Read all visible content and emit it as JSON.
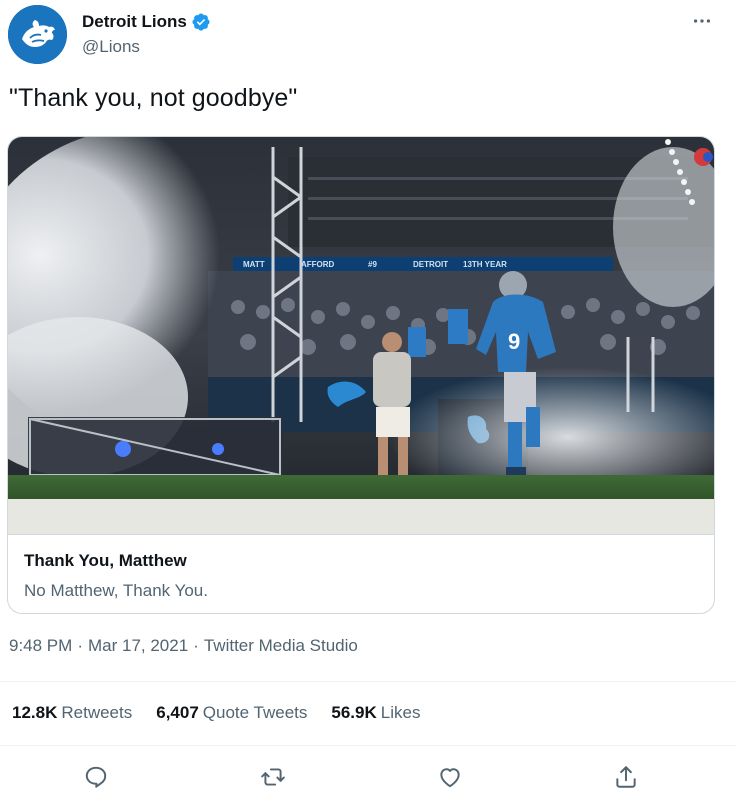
{
  "author": {
    "display_name": "Detroit Lions",
    "handle": "@Lions",
    "verified": true,
    "avatar_icon": "lions-logo-icon",
    "avatar_color": "#1a74be"
  },
  "tweet": {
    "text": "\"Thank you, not goodbye\""
  },
  "card": {
    "title": "Thank You, Matthew",
    "description": "No Matthew, Thank You."
  },
  "meta": {
    "time": "9:48 PM",
    "separator": "·",
    "date": "Mar 17, 2021",
    "source": "Twitter Media Studio"
  },
  "stats": {
    "retweets_count": "12.8K",
    "retweets_label": "Retweets",
    "quotes_count": "6,407",
    "quotes_label": "Quote Tweets",
    "likes_count": "56.9K",
    "likes_label": "Likes"
  },
  "actions": {
    "reply_icon": "reply-icon",
    "retweet_icon": "retweet-icon",
    "like_icon": "heart-icon",
    "share_icon": "share-icon"
  },
  "colors": {
    "text_primary": "#0f1419",
    "text_secondary": "#536471",
    "verified_blue": "#1d9bf0",
    "border": "#cfd9de"
  }
}
